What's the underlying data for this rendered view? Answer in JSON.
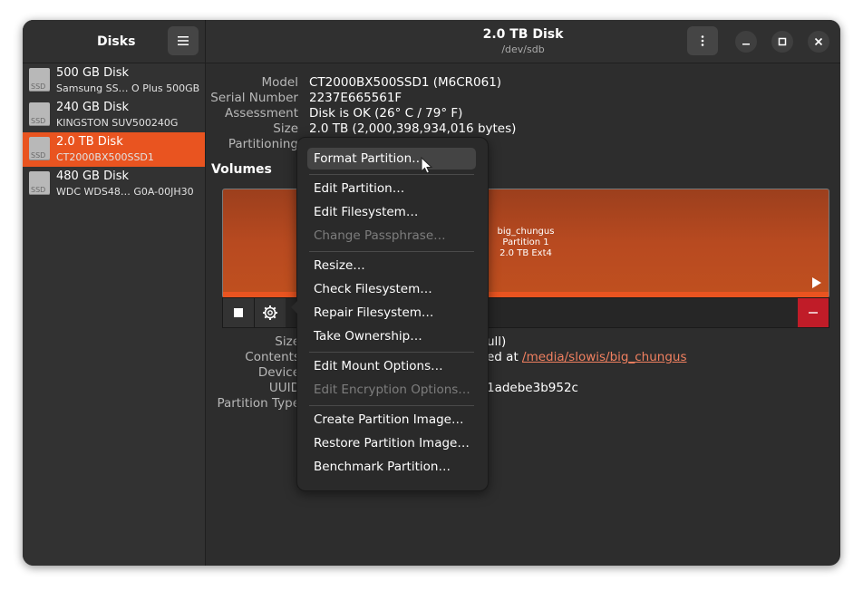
{
  "app": {
    "title": "Disks"
  },
  "header": {
    "title": "2.0 TB Disk",
    "subtitle": "/dev/sdb"
  },
  "disks": [
    {
      "name": "500 GB Disk",
      "model": "Samsung SS…  O Plus 500GB",
      "icon_label": "SSD",
      "selected": false
    },
    {
      "name": "240 GB Disk",
      "model": "KINGSTON SUV500240G",
      "icon_label": "SSD",
      "selected": false
    },
    {
      "name": "2.0 TB Disk",
      "model": "CT2000BX500SSD1",
      "icon_label": "SSD",
      "selected": true
    },
    {
      "name": "480 GB Disk",
      "model": "WDC WDS48…  G0A-00JH30",
      "icon_label": "SSD",
      "selected": false
    }
  ],
  "disk_info": {
    "model_label": "Model",
    "model": "CT2000BX500SSD1 (M6CR061)",
    "serial_label": "Serial Number",
    "serial": "2237E665561F",
    "assessment_label": "Assessment",
    "assessment": "Disk is OK (26° C / 79° F)",
    "size_label": "Size",
    "size": "2.0 TB (2,000,398,934,016 bytes)",
    "partitioning_label": "Partitioning"
  },
  "volumes": {
    "title": "Volumes",
    "partition": {
      "name": "big_chungus",
      "number": "Partition 1",
      "desc": "2.0 TB Ext4"
    }
  },
  "volume_info": {
    "size_label": "Size",
    "size_value_tail": "ull)",
    "contents_label": "Contents",
    "contents_prefix": "ed at",
    "mount_path": "/media/slowis/big_chungus",
    "device_label": "Device",
    "uuid_label": "UUID",
    "uuid_tail": "1adebe3b952c",
    "partition_type_label": "Partition Type"
  },
  "menu": {
    "items": [
      {
        "label": "Format Partition…",
        "state": "hover"
      },
      {
        "label": "Edit Partition…",
        "state": "normal"
      },
      {
        "label": "Edit Filesystem…",
        "state": "normal"
      },
      {
        "label": "Change Passphrase…",
        "state": "disabled"
      },
      {
        "label": "Resize…",
        "state": "normal"
      },
      {
        "label": "Check Filesystem…",
        "state": "normal"
      },
      {
        "label": "Repair Filesystem…",
        "state": "normal"
      },
      {
        "label": "Take Ownership…",
        "state": "normal"
      },
      {
        "label": "Edit Mount Options…",
        "state": "normal"
      },
      {
        "label": "Edit Encryption Options…",
        "state": "disabled"
      },
      {
        "label": "Create Partition Image…",
        "state": "normal"
      },
      {
        "label": "Restore Partition Image…",
        "state": "normal"
      },
      {
        "label": "Benchmark Partition…",
        "state": "normal"
      }
    ]
  },
  "colors": {
    "accent": "#e95420",
    "danger": "#c01c28",
    "link": "#f08060"
  }
}
